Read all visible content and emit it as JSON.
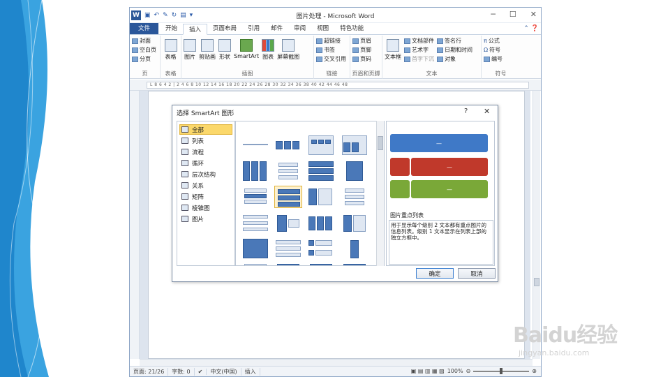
{
  "window": {
    "title": "图片处理 - Microsoft Word",
    "app_icon": "W",
    "win_buttons": [
      "─",
      "☐",
      "✕"
    ]
  },
  "tabs": [
    "文件",
    "开始",
    "插入",
    "页面布局",
    "引用",
    "邮件",
    "审阅",
    "视图",
    "特色功能"
  ],
  "tab_right": "⌃ ❓",
  "ribbon": {
    "page_group": {
      "items": [
        "封面",
        "空白页",
        "分页"
      ],
      "label": "页"
    },
    "table_group": {
      "button": "表格",
      "label": "表格"
    },
    "illus_group": {
      "buttons": [
        "图片",
        "剪贴画",
        "形状",
        "SmartArt",
        "图表",
        "屏幕截图"
      ],
      "label": "插图"
    },
    "link_group": {
      "items": [
        "超链接",
        "书签",
        "交叉引用"
      ],
      "label": "链接"
    },
    "hf_group": {
      "items": [
        "页眉",
        "页脚",
        "页码"
      ],
      "label": "页眉和页脚"
    },
    "text_group": {
      "big": "文本框",
      "items": [
        "文档部件",
        "艺术字",
        "首字下沉"
      ],
      "items2": [
        "签名行",
        "日期和时间",
        "对象"
      ],
      "label": "文本"
    },
    "symbol_group": {
      "items": [
        "公式",
        "符号",
        "编号"
      ],
      "label": "符号"
    }
  },
  "ruler_text": "L  8  6  4  2  |  2  4  6  8 10 12 14 16 18 20 22 24 26 28 30 32 34 36 38 40 42 44 46 48",
  "status": {
    "page": "页面: 21/26",
    "words": "字数: 0",
    "lang": "中文(中国)",
    "mode": "插入",
    "zoom": "100%",
    "zoom_level": 0.5
  },
  "dialog": {
    "title": "选择 SmartArt 图形",
    "help": "?",
    "close": "✕",
    "categories": [
      "全部",
      "列表",
      "流程",
      "循环",
      "层次结构",
      "关系",
      "矩阵",
      "棱锥图",
      "图片"
    ],
    "selected_category": "全部",
    "preview_name": "图片重点列表",
    "preview_desc": "用于显示每个级别 2 文本都有重点图片的信息列表。级别 1 文本显示在列表上部的独立方框中。",
    "ok": "确定",
    "cancel": "取消",
    "preview_bar_label": "—",
    "colors": {
      "blue": "#3f79c7",
      "red": "#c0392b",
      "green": "#7aa838"
    }
  },
  "watermark": {
    "brand": "Baidu经验",
    "url": "jingyan.baidu.com"
  }
}
